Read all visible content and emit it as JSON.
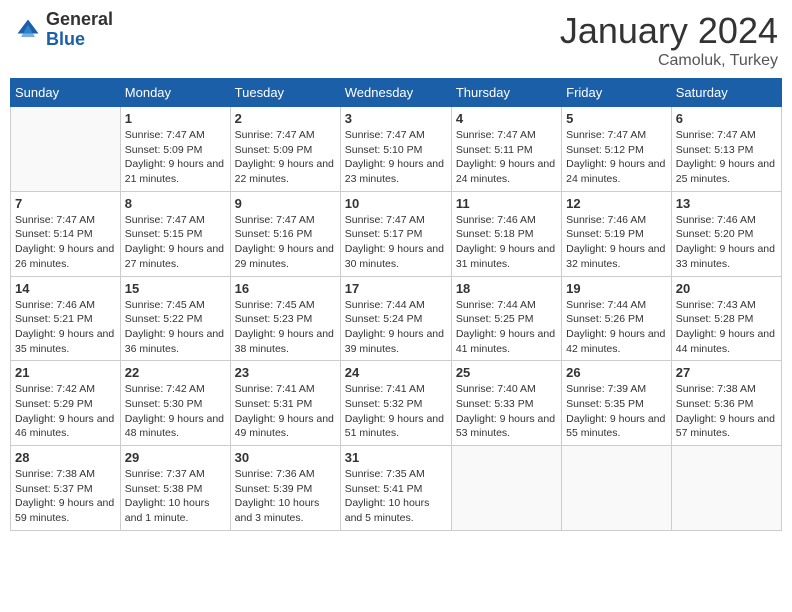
{
  "header": {
    "logo_general": "General",
    "logo_blue": "Blue",
    "month_title": "January 2024",
    "location": "Camoluk, Turkey"
  },
  "weekdays": [
    "Sunday",
    "Monday",
    "Tuesday",
    "Wednesday",
    "Thursday",
    "Friday",
    "Saturday"
  ],
  "weeks": [
    [
      {
        "day": "",
        "sunrise": "",
        "sunset": "",
        "daylight": ""
      },
      {
        "day": "1",
        "sunrise": "Sunrise: 7:47 AM",
        "sunset": "Sunset: 5:09 PM",
        "daylight": "Daylight: 9 hours and 21 minutes."
      },
      {
        "day": "2",
        "sunrise": "Sunrise: 7:47 AM",
        "sunset": "Sunset: 5:09 PM",
        "daylight": "Daylight: 9 hours and 22 minutes."
      },
      {
        "day": "3",
        "sunrise": "Sunrise: 7:47 AM",
        "sunset": "Sunset: 5:10 PM",
        "daylight": "Daylight: 9 hours and 23 minutes."
      },
      {
        "day": "4",
        "sunrise": "Sunrise: 7:47 AM",
        "sunset": "Sunset: 5:11 PM",
        "daylight": "Daylight: 9 hours and 24 minutes."
      },
      {
        "day": "5",
        "sunrise": "Sunrise: 7:47 AM",
        "sunset": "Sunset: 5:12 PM",
        "daylight": "Daylight: 9 hours and 24 minutes."
      },
      {
        "day": "6",
        "sunrise": "Sunrise: 7:47 AM",
        "sunset": "Sunset: 5:13 PM",
        "daylight": "Daylight: 9 hours and 25 minutes."
      }
    ],
    [
      {
        "day": "7",
        "sunrise": "Sunrise: 7:47 AM",
        "sunset": "Sunset: 5:14 PM",
        "daylight": "Daylight: 9 hours and 26 minutes."
      },
      {
        "day": "8",
        "sunrise": "Sunrise: 7:47 AM",
        "sunset": "Sunset: 5:15 PM",
        "daylight": "Daylight: 9 hours and 27 minutes."
      },
      {
        "day": "9",
        "sunrise": "Sunrise: 7:47 AM",
        "sunset": "Sunset: 5:16 PM",
        "daylight": "Daylight: 9 hours and 29 minutes."
      },
      {
        "day": "10",
        "sunrise": "Sunrise: 7:47 AM",
        "sunset": "Sunset: 5:17 PM",
        "daylight": "Daylight: 9 hours and 30 minutes."
      },
      {
        "day": "11",
        "sunrise": "Sunrise: 7:46 AM",
        "sunset": "Sunset: 5:18 PM",
        "daylight": "Daylight: 9 hours and 31 minutes."
      },
      {
        "day": "12",
        "sunrise": "Sunrise: 7:46 AM",
        "sunset": "Sunset: 5:19 PM",
        "daylight": "Daylight: 9 hours and 32 minutes."
      },
      {
        "day": "13",
        "sunrise": "Sunrise: 7:46 AM",
        "sunset": "Sunset: 5:20 PM",
        "daylight": "Daylight: 9 hours and 33 minutes."
      }
    ],
    [
      {
        "day": "14",
        "sunrise": "Sunrise: 7:46 AM",
        "sunset": "Sunset: 5:21 PM",
        "daylight": "Daylight: 9 hours and 35 minutes."
      },
      {
        "day": "15",
        "sunrise": "Sunrise: 7:45 AM",
        "sunset": "Sunset: 5:22 PM",
        "daylight": "Daylight: 9 hours and 36 minutes."
      },
      {
        "day": "16",
        "sunrise": "Sunrise: 7:45 AM",
        "sunset": "Sunset: 5:23 PM",
        "daylight": "Daylight: 9 hours and 38 minutes."
      },
      {
        "day": "17",
        "sunrise": "Sunrise: 7:44 AM",
        "sunset": "Sunset: 5:24 PM",
        "daylight": "Daylight: 9 hours and 39 minutes."
      },
      {
        "day": "18",
        "sunrise": "Sunrise: 7:44 AM",
        "sunset": "Sunset: 5:25 PM",
        "daylight": "Daylight: 9 hours and 41 minutes."
      },
      {
        "day": "19",
        "sunrise": "Sunrise: 7:44 AM",
        "sunset": "Sunset: 5:26 PM",
        "daylight": "Daylight: 9 hours and 42 minutes."
      },
      {
        "day": "20",
        "sunrise": "Sunrise: 7:43 AM",
        "sunset": "Sunset: 5:28 PM",
        "daylight": "Daylight: 9 hours and 44 minutes."
      }
    ],
    [
      {
        "day": "21",
        "sunrise": "Sunrise: 7:42 AM",
        "sunset": "Sunset: 5:29 PM",
        "daylight": "Daylight: 9 hours and 46 minutes."
      },
      {
        "day": "22",
        "sunrise": "Sunrise: 7:42 AM",
        "sunset": "Sunset: 5:30 PM",
        "daylight": "Daylight: 9 hours and 48 minutes."
      },
      {
        "day": "23",
        "sunrise": "Sunrise: 7:41 AM",
        "sunset": "Sunset: 5:31 PM",
        "daylight": "Daylight: 9 hours and 49 minutes."
      },
      {
        "day": "24",
        "sunrise": "Sunrise: 7:41 AM",
        "sunset": "Sunset: 5:32 PM",
        "daylight": "Daylight: 9 hours and 51 minutes."
      },
      {
        "day": "25",
        "sunrise": "Sunrise: 7:40 AM",
        "sunset": "Sunset: 5:33 PM",
        "daylight": "Daylight: 9 hours and 53 minutes."
      },
      {
        "day": "26",
        "sunrise": "Sunrise: 7:39 AM",
        "sunset": "Sunset: 5:35 PM",
        "daylight": "Daylight: 9 hours and 55 minutes."
      },
      {
        "day": "27",
        "sunrise": "Sunrise: 7:38 AM",
        "sunset": "Sunset: 5:36 PM",
        "daylight": "Daylight: 9 hours and 57 minutes."
      }
    ],
    [
      {
        "day": "28",
        "sunrise": "Sunrise: 7:38 AM",
        "sunset": "Sunset: 5:37 PM",
        "daylight": "Daylight: 9 hours and 59 minutes."
      },
      {
        "day": "29",
        "sunrise": "Sunrise: 7:37 AM",
        "sunset": "Sunset: 5:38 PM",
        "daylight": "Daylight: 10 hours and 1 minute."
      },
      {
        "day": "30",
        "sunrise": "Sunrise: 7:36 AM",
        "sunset": "Sunset: 5:39 PM",
        "daylight": "Daylight: 10 hours and 3 minutes."
      },
      {
        "day": "31",
        "sunrise": "Sunrise: 7:35 AM",
        "sunset": "Sunset: 5:41 PM",
        "daylight": "Daylight: 10 hours and 5 minutes."
      },
      {
        "day": "",
        "sunrise": "",
        "sunset": "",
        "daylight": ""
      },
      {
        "day": "",
        "sunrise": "",
        "sunset": "",
        "daylight": ""
      },
      {
        "day": "",
        "sunrise": "",
        "sunset": "",
        "daylight": ""
      }
    ]
  ]
}
